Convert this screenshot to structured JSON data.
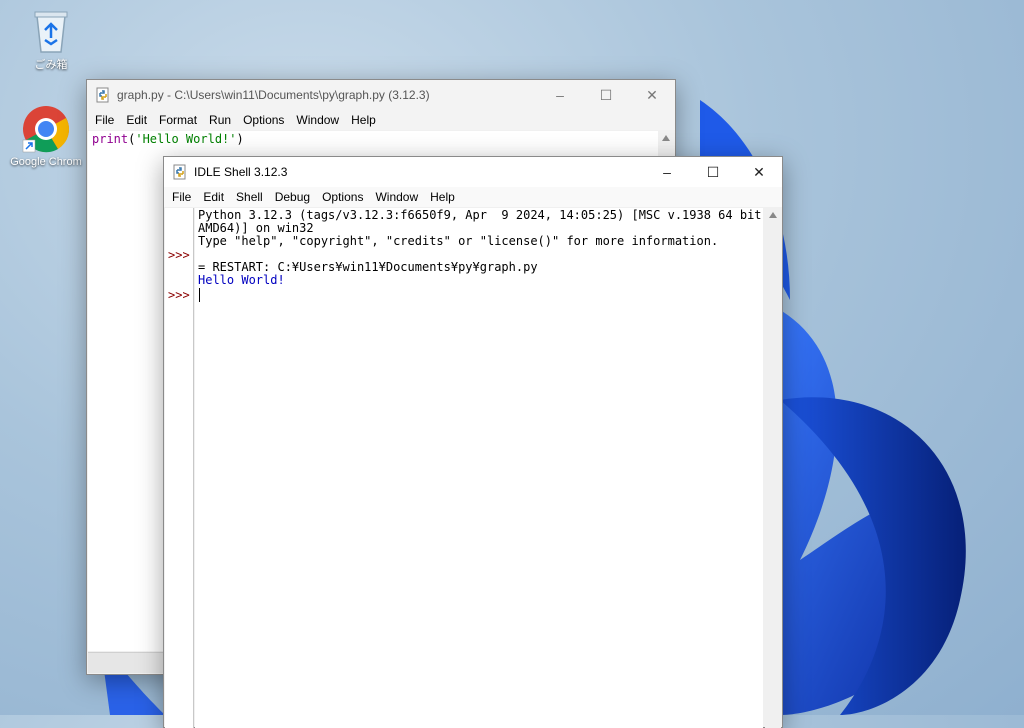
{
  "desktop": {
    "icons": [
      {
        "label": "ごみ箱",
        "icon": "recycle-bin-icon"
      },
      {
        "label": "Google Chrom",
        "icon": "chrome-icon"
      }
    ]
  },
  "editor": {
    "title": "graph.py - C:\\Users\\win11\\Documents\\py\\graph.py (3.12.3)",
    "menu": [
      "File",
      "Edit",
      "Format",
      "Run",
      "Options",
      "Window",
      "Help"
    ],
    "code": {
      "keyword": "print",
      "open": "(",
      "string": "'Hello World!'",
      "close": ")"
    }
  },
  "shell": {
    "title": "IDLE Shell 3.12.3",
    "menu": [
      "File",
      "Edit",
      "Shell",
      "Debug",
      "Options",
      "Window",
      "Help"
    ],
    "lines": [
      "Python 3.12.3 (tags/v3.12.3:f6650f9, Apr  9 2024, 14:05:25) [MSC v.1938 64 bit (",
      "AMD64)] on win32",
      "Type \"help\", \"copyright\", \"credits\" or \"license()\" for more information.",
      "= RESTART: C:¥Users¥win11¥Documents¥py¥graph.py",
      "Hello World!"
    ],
    "prompt": ">>>"
  },
  "colors": {
    "keyword": "#900090",
    "string": "#008000",
    "output": "#0000c0",
    "prompt": "#8b0000"
  }
}
